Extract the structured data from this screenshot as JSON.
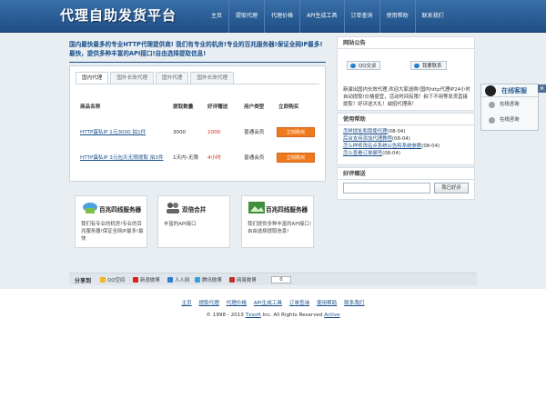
{
  "header": {
    "logo": "代理自助发货平台",
    "nav": [
      "主页",
      "提取代理",
      "代理价格",
      "API生成工具",
      "订单查询",
      "使用帮助",
      "联系我们"
    ]
  },
  "promo": "国内最快最多的专业HTTP代理提供商! 我们有专业的机房!专业的百兆服务器!保证全网IP最多!最快，提供多种丰富的API接口!自由选择提取信息!",
  "tabs": [
    "国内代理",
    "国外长效代理",
    "国外代理",
    "国外长效代理"
  ],
  "table": {
    "headers": [
      "商品名称",
      "提取数量",
      "好评赠送",
      "用户类型",
      "立即购买"
    ],
    "rows": [
      {
        "name": "HTTP蛋私IP 1元3000 拍1件",
        "qty": "3000",
        "bonus": "1000",
        "user_type": "普通会员",
        "buy": "立刻购买"
      },
      {
        "name": "HTTP蛋私IP 3元包天无限提取 拍3件",
        "qty": "1天内-无限",
        "bonus": "4小时",
        "user_type": "普通会员",
        "buy": "立刻购买"
      }
    ]
  },
  "features": [
    {
      "title": "百兆四线服务器",
      "desc": "我们有专业的机房!专业的百兆服务器!保证全网IP最多!最快"
    },
    {
      "title": "双倍合并",
      "desc": "丰富的API接口"
    },
    {
      "title": "百兆四线服务器",
      "desc": "我们提供多种丰富的API接口!自由选择提取信息!"
    }
  ],
  "sidebar": {
    "notice_title": "网站公告",
    "qq_login": "QQ交谈",
    "qq_wb": "我要联系",
    "notice_text": "新激出国内长效代理,欢迎大家选购!国内http代理IP24小时自动提取!价格便宜，活动时间有限！拍下不用等发货直接提取！好评送大礼！诚招代理商！",
    "help_title": "使用帮助",
    "help_links": [
      {
        "text": "怎样提址和我使代理",
        "date": "(08-04)"
      },
      {
        "text": "后台支持添加代理教程",
        "date": "(08-04)"
      },
      {
        "text": "怎么样修改站点系统公告和系统参数",
        "date": "(08-04)"
      },
      {
        "text": "怎么查看订单编号",
        "date": "(08-04)"
      }
    ],
    "review_title": "好评赠送",
    "search_button": "我已好评"
  },
  "service": {
    "title": "在线客服",
    "close": "×",
    "items": [
      "在线咨询",
      "在线咨询"
    ]
  },
  "share": {
    "label": "分享到",
    "items": [
      "QQ空间",
      "新浪微博",
      "人人网",
      "腾讯微博",
      "网易微博"
    ],
    "count": "0"
  },
  "footer": {
    "links": [
      "主页",
      "提取代理",
      "代理价格",
      "API生成工具",
      "订单查询",
      "使用帮助",
      "联系我们"
    ],
    "copyright_prefix": "© 1998 - 2013",
    "company": "Txsoft",
    "copyright_mid": "Inc. All Rights Reserved",
    "active": "Active"
  },
  "colors": {
    "header_blue": "#1e4f86",
    "link_blue": "#1a4f8b",
    "buy_orange": "#ef7a1d",
    "price_red": "#d9231a"
  }
}
